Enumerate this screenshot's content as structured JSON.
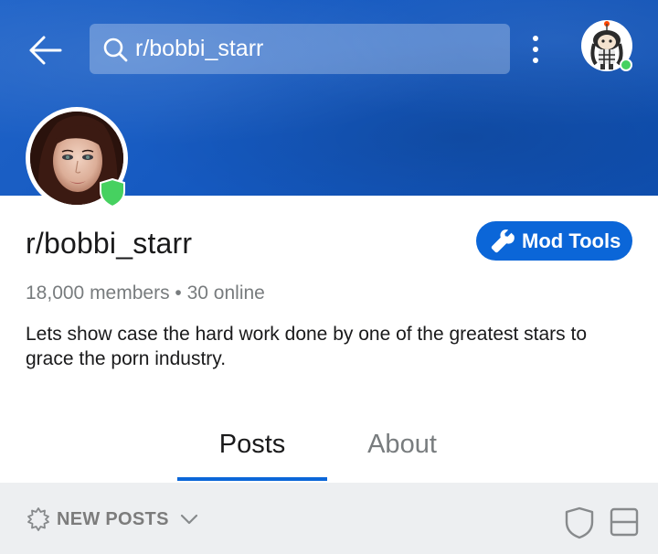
{
  "header": {
    "search_text": "r/bobbi_starr"
  },
  "subreddit": {
    "name": "r/bobbi_starr",
    "stats": "18,000 members • 30 online",
    "description": "Lets show case the hard work done by one of the greatest stars to grace the porn industry.",
    "mod_tools_label": "Mod Tools"
  },
  "tabs": [
    {
      "label": "Posts",
      "active": true
    },
    {
      "label": "About",
      "active": false
    }
  ],
  "sort": {
    "label": "NEW POSTS"
  },
  "colors": {
    "banner": "#1559c0",
    "accent": "#0b66d8",
    "online": "#46d160",
    "mod_badge": "#46d160"
  },
  "icons": [
    "back-arrow-icon",
    "search-icon",
    "kebab-menu-icon",
    "user-avatar",
    "mod-shield-icon",
    "wrench-icon",
    "sparkle-icon",
    "chevron-down-icon",
    "shield-icon",
    "card-view-icon"
  ]
}
